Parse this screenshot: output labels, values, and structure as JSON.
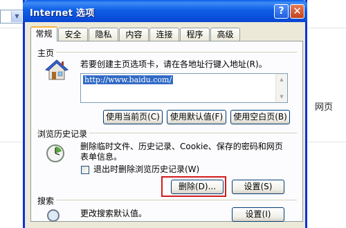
{
  "background": {
    "webpage_label": "网页"
  },
  "dialog": {
    "title": "Internet 选项",
    "help_button": "?",
    "close_button": "✕",
    "tabs": [
      {
        "label": "常规",
        "active": true
      },
      {
        "label": "安全",
        "active": false
      },
      {
        "label": "隐私",
        "active": false
      },
      {
        "label": "内容",
        "active": false
      },
      {
        "label": "连接",
        "active": false
      },
      {
        "label": "程序",
        "active": false
      },
      {
        "label": "高级",
        "active": false
      }
    ],
    "homepage": {
      "heading": "主页",
      "description": "若要创建主页选项卡，请在各地址行键入地址(R)。",
      "url": "http://www.baidu.com/",
      "buttons": {
        "use_current": "使用当前页(C)",
        "use_default": "使用默认值(F)",
        "use_blank": "使用空白页(B)"
      }
    },
    "history": {
      "heading": "浏览历史记录",
      "description_line1": "删除临时文件、历史记录、Cookie、保存的密码和网页",
      "description_line2": "表单信息。",
      "checkbox_label": "退出时删除浏览历史记录(W)",
      "checkbox_checked": false,
      "buttons": {
        "delete": "删除(D)...",
        "settings": "设置(S)"
      }
    },
    "search": {
      "heading": "搜索",
      "description": "更改搜索默认值。",
      "settings_button": "设置(I)"
    }
  },
  "colors": {
    "titlebar": "#0a5ee8",
    "dialog_bg": "#ece9d8",
    "highlight_box": "#d21b1b",
    "selection": "#316ac5"
  }
}
